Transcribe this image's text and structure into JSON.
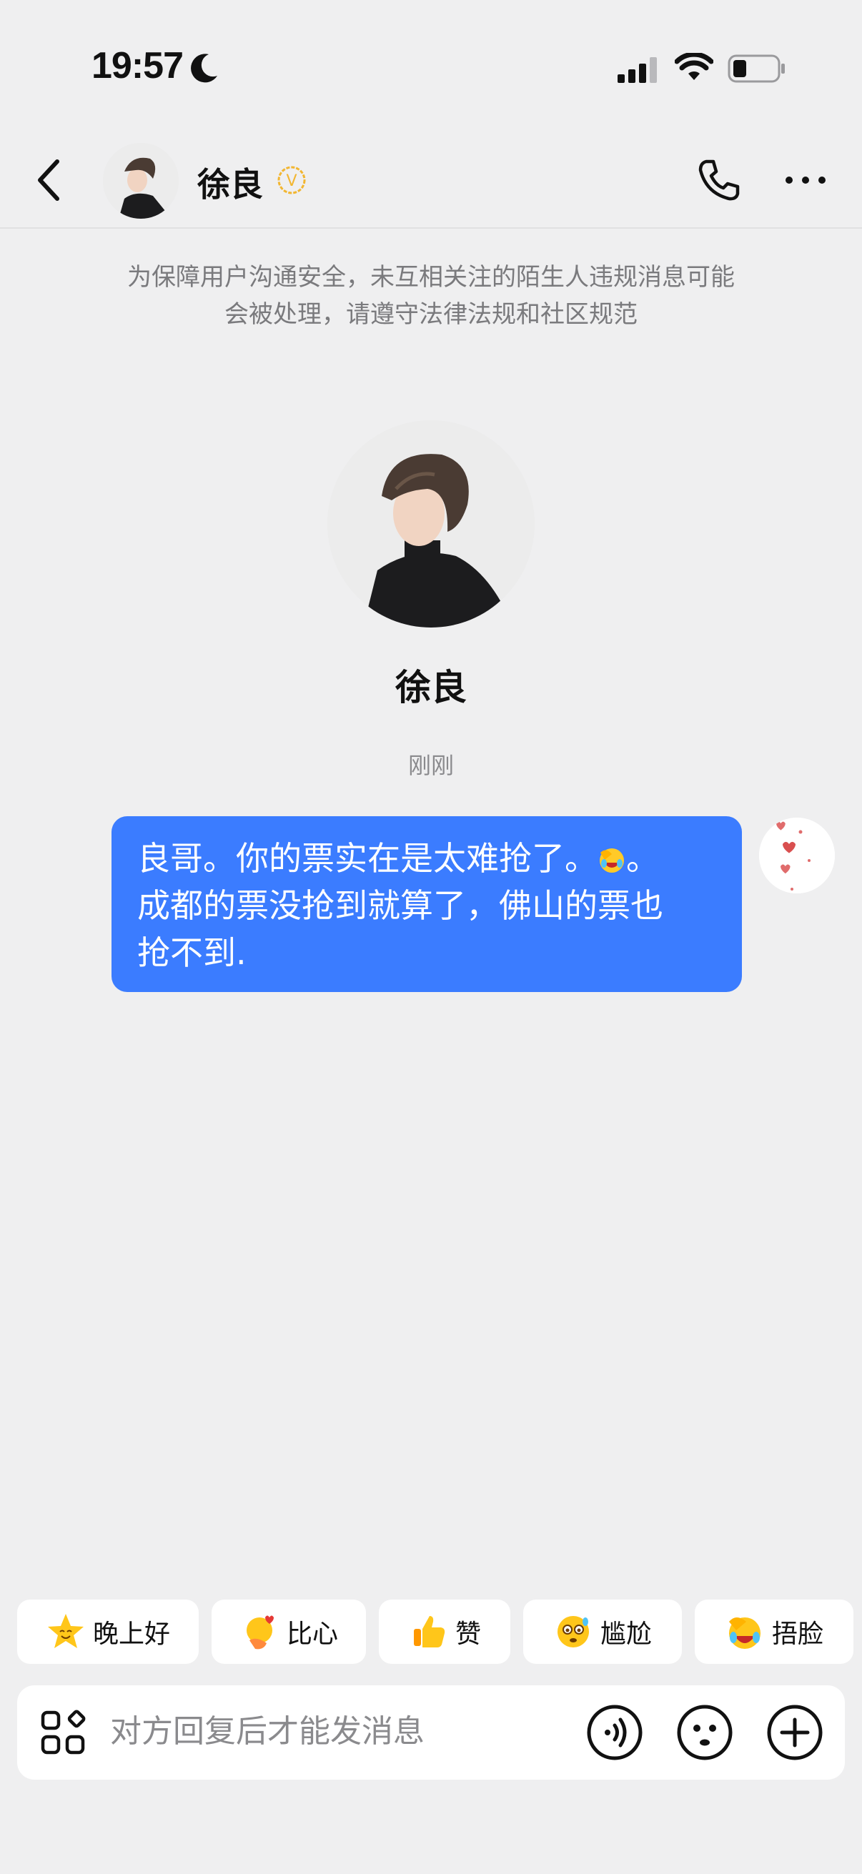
{
  "status_bar": {
    "time": "19:57"
  },
  "header": {
    "contact_name": "徐良",
    "verified_mark": "V"
  },
  "notice": {
    "line1": "为保障用户沟通安全，未互相关注的陌生人违规消息可能",
    "line2": "会被处理，请遵守法律法规和社区规范"
  },
  "profile": {
    "name": "徐良"
  },
  "timestamp": "刚刚",
  "message": {
    "line1_a": "良哥。你的票实在是太难抢了。",
    "line1_b": "。",
    "line2": "成都的票没抢到就算了，佛山的票也",
    "line3": "抢不到."
  },
  "quick_replies": [
    {
      "label": "晚上好",
      "icon": "star-face-icon"
    },
    {
      "label": "比心",
      "icon": "finger-heart-icon"
    },
    {
      "label": "赞",
      "icon": "thumbs-up-icon"
    },
    {
      "label": "尴尬",
      "icon": "awkward-face-icon"
    },
    {
      "label": "捂脸",
      "icon": "facepalm-icon"
    }
  ],
  "input": {
    "placeholder": "对方回复后才能发消息"
  },
  "colors": {
    "accent": "#3b7cff",
    "verified": "#f2b631",
    "background": "#efeff0"
  }
}
